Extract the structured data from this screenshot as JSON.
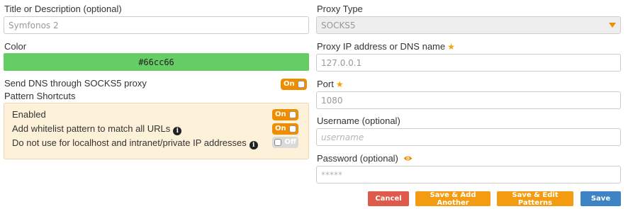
{
  "left": {
    "title_label": "Title or Description (optional)",
    "title_value": "Symfonos 2",
    "color_label": "Color",
    "color_value": "#66cc66",
    "dns_label": "Send DNS through SOCKS5 proxy",
    "dns_toggle": "On",
    "shortcuts_label": "Pattern Shortcuts",
    "shortcuts": [
      {
        "label": "Enabled",
        "toggle": "On",
        "info": false
      },
      {
        "label": "Add whitelist pattern to match all URLs",
        "toggle": "On",
        "info": true
      },
      {
        "label": "Do not use for localhost and intranet/private IP addresses",
        "toggle": "Off",
        "info": true
      }
    ]
  },
  "right": {
    "proxy_type_label": "Proxy Type",
    "proxy_type_value": "SOCKS5",
    "ip_label": "Proxy IP address or DNS name",
    "ip_value": "127.0.0.1",
    "port_label": "Port",
    "port_value": "1080",
    "username_label": "Username (optional)",
    "username_placeholder": "username",
    "password_label": "Password (optional)",
    "password_placeholder": "*****"
  },
  "buttons": {
    "cancel": "Cancel",
    "save_add": "Save & Add Another",
    "save_edit": "Save & Edit Patterns",
    "save": "Save"
  },
  "colors": {
    "swatch": "#66cc66",
    "accent": "#f08c00",
    "cancel": "#e05a4b",
    "save_add": "#f39c12",
    "save": "#3d84c6",
    "shortcuts_bg": "#fdf1da"
  },
  "icons": {
    "required": "star-icon",
    "info": "info-icon",
    "dropdown": "caret-down-icon",
    "reveal": "eye-icon"
  }
}
